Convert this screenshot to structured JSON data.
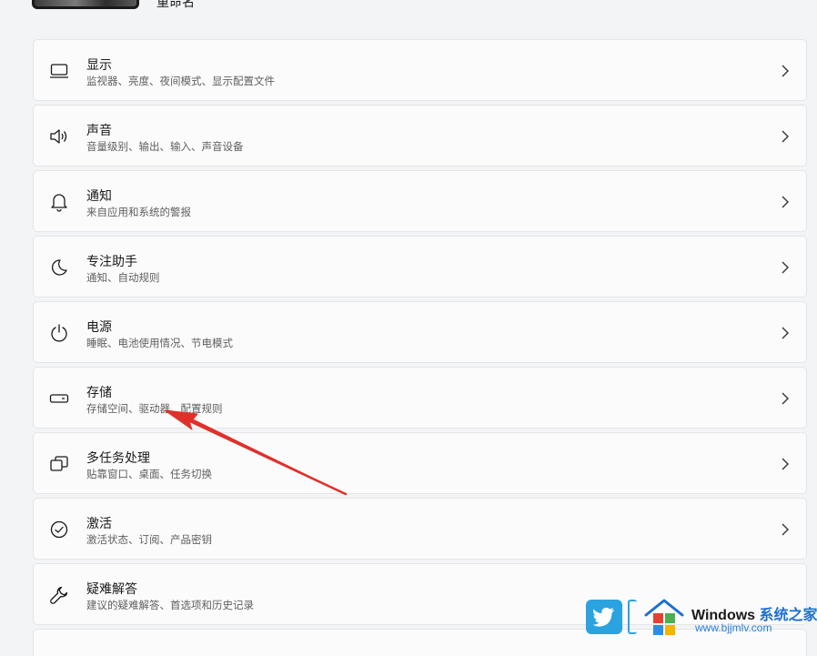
{
  "header": {
    "rename_label": "重命名"
  },
  "settings": [
    {
      "title": "显示",
      "subtitle": "监视器、亮度、夜间模式、显示配置文件",
      "icon": "monitor-icon"
    },
    {
      "title": "声音",
      "subtitle": "音量级别、输出、输入、声音设备",
      "icon": "speaker-icon"
    },
    {
      "title": "通知",
      "subtitle": "来自应用和系统的警报",
      "icon": "bell-icon"
    },
    {
      "title": "专注助手",
      "subtitle": "通知、自动规则",
      "icon": "moon-icon"
    },
    {
      "title": "电源",
      "subtitle": "睡眠、电池使用情况、节电模式",
      "icon": "power-icon"
    },
    {
      "title": "存储",
      "subtitle": "存储空间、驱动器、配置规则",
      "icon": "storage-icon"
    },
    {
      "title": "多任务处理",
      "subtitle": "贴靠窗口、桌面、任务切换",
      "icon": "multitask-icon"
    },
    {
      "title": "激活",
      "subtitle": "激活状态、订阅、产品密钥",
      "icon": "checkmark-circle-icon"
    },
    {
      "title": "疑难解答",
      "subtitle": "建议的疑难解答、首选项和历史记录",
      "icon": "wrench-icon"
    }
  ],
  "annotation": {
    "color": "#e0302a",
    "points_to": "存储"
  },
  "watermark": {
    "brand": "Windows",
    "brand_cn": "系统之家",
    "url": "www.bjjmlv.com"
  }
}
